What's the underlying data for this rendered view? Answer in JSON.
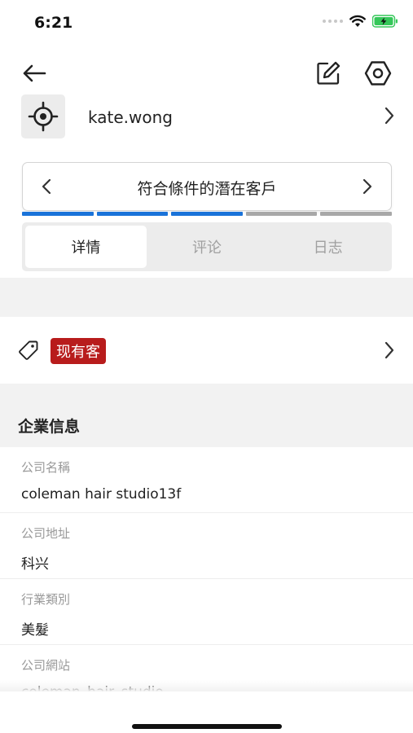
{
  "status_bar": {
    "time": "6:21",
    "icons": [
      "signal-dots-icon",
      "wifi-icon",
      "battery-charging-icon"
    ],
    "battery_color": "#35c759"
  },
  "nav": {
    "back_icon": "arrow-left-icon",
    "edit_icon": "edit-icon",
    "settings_icon": "hexagon-settings-icon"
  },
  "user": {
    "avatar_icon": "crosshair-icon",
    "name": "kate.wong"
  },
  "stage": {
    "label": "符合條件的潛在客戶",
    "steps": [
      {
        "state": "done"
      },
      {
        "state": "done"
      },
      {
        "state": "done"
      },
      {
        "state": "pending"
      },
      {
        "state": "pending"
      }
    ],
    "done_color": "#1a73d9",
    "pending_color": "#a8a8a8"
  },
  "tabs": [
    {
      "label": "详情",
      "active": true
    },
    {
      "label": "评论",
      "active": false
    },
    {
      "label": "日志",
      "active": false
    }
  ],
  "tag": {
    "icon": "tag-icon",
    "label": "现有客",
    "color": "#b81c1c"
  },
  "section": {
    "title": "企業信息"
  },
  "fields": [
    {
      "label": "公司名稱",
      "value": "coleman hair studio13f"
    },
    {
      "label": "公司地址",
      "value": "科兴"
    },
    {
      "label": "行業類別",
      "value": "美髮"
    },
    {
      "label": "公司網站",
      "value": "coleman_hair_studio"
    }
  ]
}
